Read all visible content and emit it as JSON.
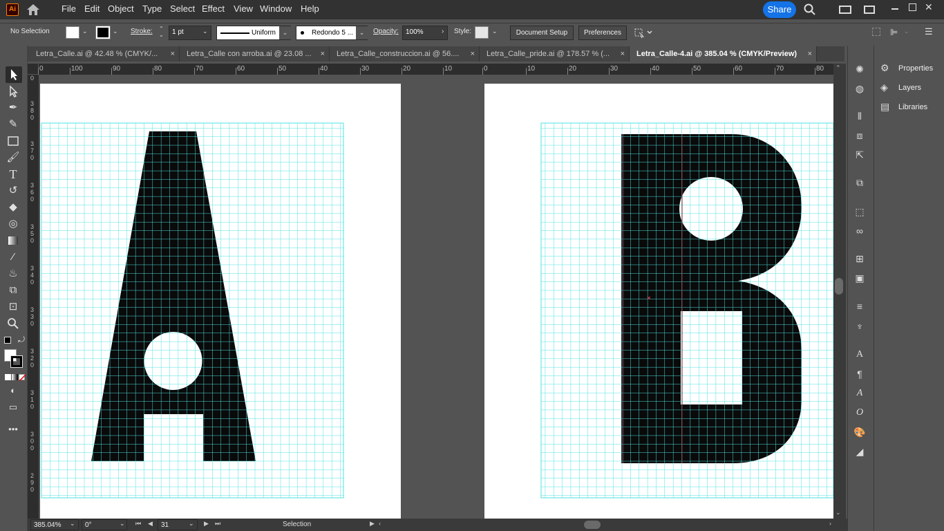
{
  "app": {
    "logo_text": "Ai",
    "menu": [
      "File",
      "Edit",
      "Object",
      "Type",
      "Select",
      "Effect",
      "View",
      "Window",
      "Help"
    ],
    "share_label": "Share"
  },
  "control_bar": {
    "selection_status": "No Selection",
    "stroke_label": "Stroke:",
    "stroke_weight": "1 pt",
    "stroke_profile": "Uniform",
    "brush": "Redondo 5 ...",
    "opacity_label": "Opacity:",
    "opacity_value": "100%",
    "style_label": "Style:",
    "document_setup": "Document Setup",
    "preferences": "Preferences"
  },
  "tabs": [
    {
      "label": "Letra_Calle.ai @ 42.48 % (CMYK/...",
      "active": false
    },
    {
      "label": "Letra_Calle con arroba.ai @ 23.08 ...",
      "active": false
    },
    {
      "label": "Letra_Calle_construccion.ai @ 56....",
      "active": false
    },
    {
      "label": "Letra_Calle_pride.ai @ 178.57 % (...",
      "active": false
    },
    {
      "label": "Letra_Calle-4.ai @ 385.04 % (CMYK/Preview)",
      "active": true
    }
  ],
  "ruler_h": [
    "0",
    "100",
    "90",
    "80",
    "70",
    "60",
    "50",
    "40",
    "30",
    "20",
    "10",
    "0",
    "10",
    "20",
    "30",
    "40",
    "50",
    "60",
    "70",
    "80"
  ],
  "ruler_v": [
    {
      "digits": [
        "0"
      ]
    },
    {
      "digits": [
        "3",
        "8",
        "0"
      ]
    },
    {
      "digits": [
        "3",
        "7",
        "0"
      ]
    },
    {
      "digits": [
        "3",
        "6",
        "0"
      ]
    },
    {
      "digits": [
        "3",
        "5",
        "0"
      ]
    },
    {
      "digits": [
        "3",
        "4",
        "0"
      ]
    },
    {
      "digits": [
        "3",
        "3",
        "0"
      ]
    },
    {
      "digits": [
        "3",
        "2",
        "0"
      ]
    },
    {
      "digits": [
        "3",
        "1",
        "0"
      ]
    },
    {
      "digits": [
        "3",
        "0",
        "0"
      ]
    },
    {
      "digits": [
        "2",
        "9",
        "0"
      ]
    }
  ],
  "panels": [
    "Properties",
    "Layers",
    "Libraries"
  ],
  "status_bar": {
    "zoom": "385.04%",
    "rotation": "0°",
    "artboard_number": "31",
    "tool_name": "Selection"
  },
  "colors": {
    "grid": "#4de1e1",
    "glyph": "#0a0a0a",
    "accent": "#1473e6"
  }
}
